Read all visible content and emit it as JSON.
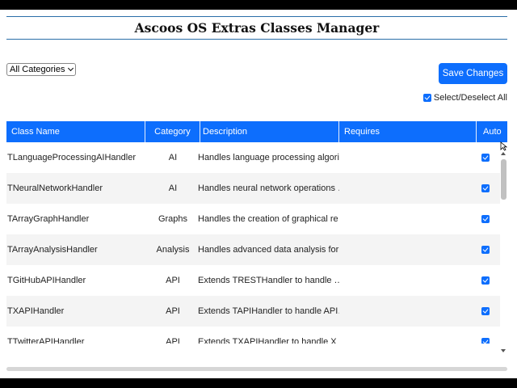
{
  "header": {
    "title": "Ascoos OS Extras Classes Manager"
  },
  "filter": {
    "category_value": "All Categories"
  },
  "toolbar": {
    "save_label": "Save Changes",
    "select_all_label": "Select/Deselect All"
  },
  "table": {
    "columns": [
      "Class Name",
      "Category",
      "Description",
      "Requires",
      "Auto"
    ],
    "rows": [
      {
        "name": "TLanguageProcessingAIHandler",
        "category": "AI",
        "description": "Handles language processing algori…",
        "requires": "",
        "auto": true
      },
      {
        "name": "TNeuralNetworkHandler",
        "category": "AI",
        "description": "Handles neural network operations …",
        "requires": "",
        "auto": true
      },
      {
        "name": "TArrayGraphHandler",
        "category": "Graphs",
        "description": "Handles the creation of graphical re…",
        "requires": "",
        "auto": true
      },
      {
        "name": "TArrayAnalysisHandler",
        "category": "Analysis",
        "description": "Handles advanced data analysis for…",
        "requires": "",
        "auto": true
      },
      {
        "name": "TGitHubAPIHandler",
        "category": "API",
        "description": "Extends TRESTHandler to handle …",
        "requires": "",
        "auto": true
      },
      {
        "name": "TXAPIHandler",
        "category": "API",
        "description": "Extends TAPIHandler to handle API…",
        "requires": "",
        "auto": true
      },
      {
        "name": "TTwitterAPIHandler",
        "category": "API",
        "description": "Extends TXAPIHandler to handle X …",
        "requires": "",
        "auto": true
      }
    ]
  },
  "colors": {
    "accent": "#0d6efd",
    "title_rule": "#2a6ea8",
    "row_alt": "#f4f4f4"
  }
}
